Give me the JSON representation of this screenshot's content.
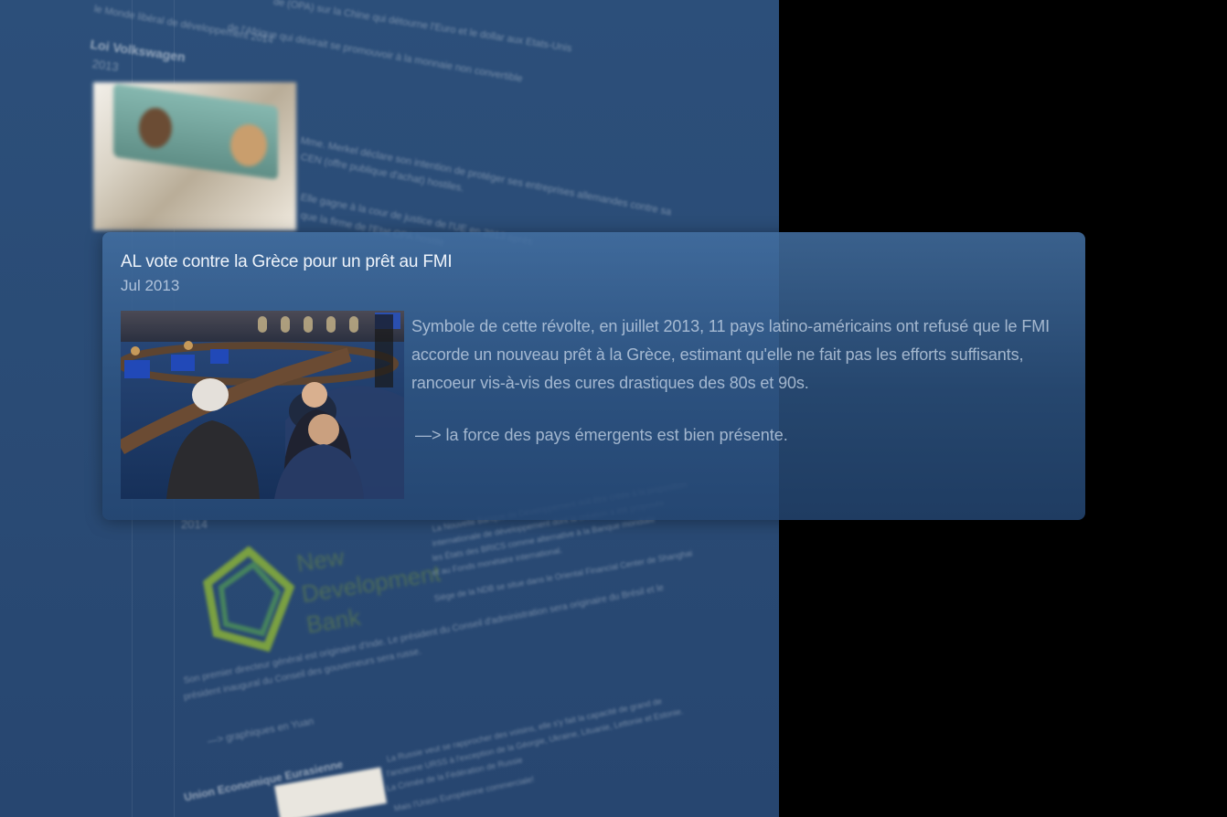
{
  "background_timeline": {
    "entries": [
      {
        "heading": "Loi Volkswagen",
        "date": "2013",
        "lines": [
          "Mme. Merkel déclare son intention de protéger ses entreprises allemandes contre sa",
          "CEN (offre publique d'achat) hostiles.",
          "Elle gagne à la cour de justice de l'UE en 2013 après",
          "que la firme de l'Etat OPA hostile"
        ]
      }
    ],
    "top_lines": [
      "de (OPA) sur la Chine qui détourne l'Euro et le dollar aux Etats-Unis",
      "le Monde libéral de développement 2014",
      "de l'Afrique qui désirait se promouvoir à la monnaie non convertible"
    ],
    "lower_lines": [
      "2014",
      "La Nouvelle Banque de Développement doit être créée à la proposition",
      "internationale de développement dont la création a été proposée",
      "les États des BRICS comme alternative à la Banque mondiale",
      "et au Fonds monétaire international.",
      "Siège de la NDB se situe dans le Oriental Financial Center de Shanghai",
      "Son premier directeur général est originaire d'Inde. Le président du Conseil d'administration sera originaire du Brésil et le",
      "président inaugural du Conseil des gouverneurs sera russe.",
      "—> graphiques en Yuan",
      "Union Economique Eurasienne",
      "La Russie veut se rapprocher des voisins, elle s'y fait la capacité de grand de",
      "l'ancienne URSS à l'exception de la Géorgie, Ukraine, Lituanie, Lettonie et Estonie.",
      "La Crimée de la Fédération de Russie",
      "Mais l'Union Européenne commerciale!"
    ],
    "logo_text": [
      "New",
      "Development",
      "Bank"
    ]
  },
  "card": {
    "title": "AL vote contre la Grèce pour un prêt au FMI",
    "date": "Jul 2013",
    "body": "Symbole de cette révolte, en juillet 2013, 11 pays latino-américains ont refusé que le FMI accorde un nouveau prêt à la Grèce, estimant qu'elle ne fait pas les efforts suffisants, rancoeur vis-à-vis des cures drastiques des 80s et 90s.",
    "note": "—> la force des pays émergents est bien présente.",
    "photo_icon": "meeting-photo"
  },
  "colors": {
    "panel": "#2b4d78",
    "card_top": "#426ea0",
    "card_bottom": "#244672",
    "outside": "#000000"
  }
}
